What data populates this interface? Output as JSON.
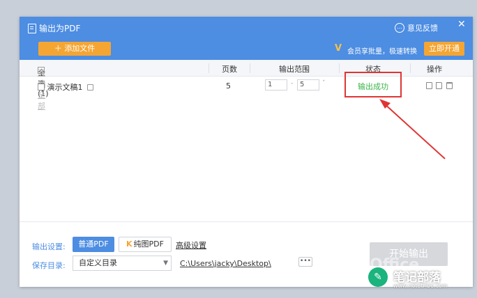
{
  "window": {
    "title": "输出为PDF",
    "feedback_label": "意见反馈",
    "close_glyph": "✕"
  },
  "toolbar": {
    "add_file_label": "＋ 添加文件",
    "vip_text": "会员享批量，极速转换",
    "open_vip_label": "立即开通"
  },
  "table": {
    "select_all_label": "全选 (1)",
    "clear_all_label": "清除全部",
    "headers": [
      "页数",
      "输出范围",
      "状态",
      "操作"
    ],
    "rows": [
      {
        "name": "演示文稿1",
        "pages": "5",
        "range_from": "1",
        "range_to": "5",
        "status": "输出成功"
      }
    ]
  },
  "footer": {
    "output_settings_label": "输出设置:",
    "normal_pdf_label": "普通PDF",
    "pure_pdf_label": "纯图PDF",
    "advanced_label": "高级设置",
    "save_dir_label": "保存目录:",
    "dir_option": "自定义目录",
    "path": "C:\\Users\\jacky\\Desktop\\",
    "more_label": "•••",
    "start_label": "开始输出"
  },
  "watermark": {
    "brand": "笔记部落",
    "site": "www.notetribe.com",
    "office": "Office"
  },
  "colors": {
    "accent": "#4d8de2",
    "orange": "#f5a532",
    "success": "#39b54a",
    "highlight": "#e03434"
  }
}
